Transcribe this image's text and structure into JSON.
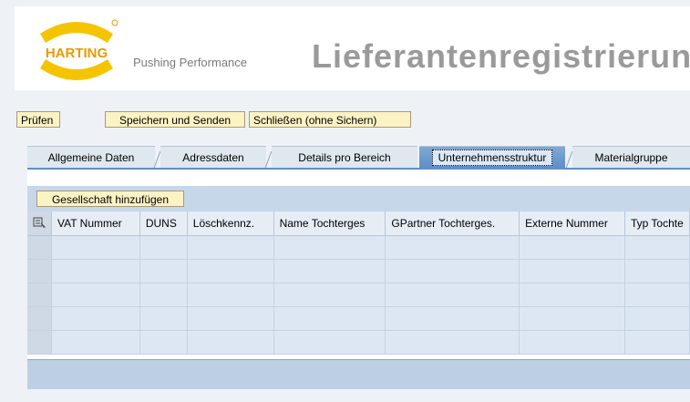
{
  "header": {
    "logo_text": "HARTING",
    "tagline": "Pushing Performance",
    "title": "Lieferantenregistrierung"
  },
  "toolbar": {
    "check_label": "Prüfen",
    "save_send_label": "Speichern und Senden",
    "close_label": "Schließen (ohne Sichern)"
  },
  "tabs": [
    {
      "label": "Allgemeine Daten"
    },
    {
      "label": "Adressdaten"
    },
    {
      "label": "Details pro Bereich"
    },
    {
      "label": "Unternehmensstruktur"
    },
    {
      "label": "Materialgruppe"
    }
  ],
  "panel": {
    "add_company_label": "Gesellschaft hinzufügen"
  },
  "table": {
    "columns": [
      "VAT Nummer",
      "DUNS",
      "Löschkennz.",
      "Name Tochterges",
      "GPartner Tochterges.",
      "Externe Nummer",
      "Typ Tochte"
    ]
  },
  "colors": {
    "button_bg": "#fcf3c4",
    "active_tab": "#5f8fc8",
    "logo_yellow": "#f5c400",
    "logo_orange": "#e89a00"
  }
}
